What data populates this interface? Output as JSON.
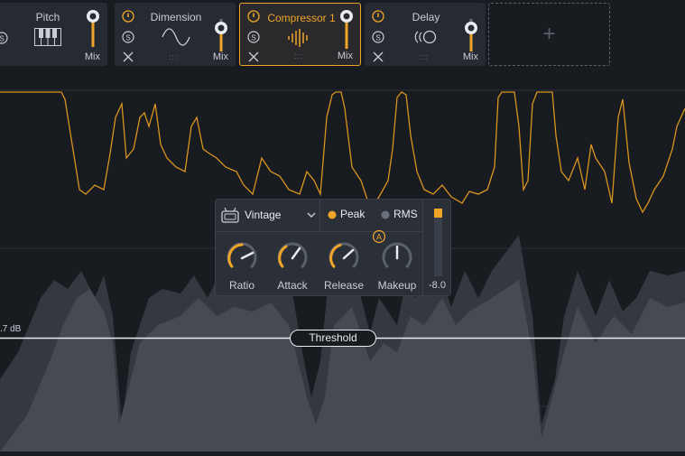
{
  "modules": [
    {
      "title": "Pitch",
      "mix_label": "Mix"
    },
    {
      "title": "Dimension",
      "mix_label": "Mix"
    },
    {
      "title": "Compressor 1",
      "mix_label": "Mix"
    },
    {
      "title": "Delay",
      "mix_label": "Mix"
    }
  ],
  "add_module_icon": "plus-icon",
  "compressor_panel": {
    "mode_label": "Vintage",
    "detection": [
      {
        "label": "Peak",
        "selected": true
      },
      {
        "label": "RMS",
        "selected": false
      }
    ],
    "knobs": [
      {
        "label": "Ratio",
        "value": 0.62
      },
      {
        "label": "Attack",
        "value": 0.45
      },
      {
        "label": "Release",
        "value": 0.55
      },
      {
        "label": "Makeup",
        "value": 0.0
      }
    ],
    "auto_badge": "A",
    "meter_value": "-8.0"
  },
  "threshold": {
    "label": "Threshold",
    "db_readout": ".7 dB"
  },
  "colors": {
    "accent": "#f0a528",
    "background": "#181b20",
    "module": "#262b33"
  }
}
